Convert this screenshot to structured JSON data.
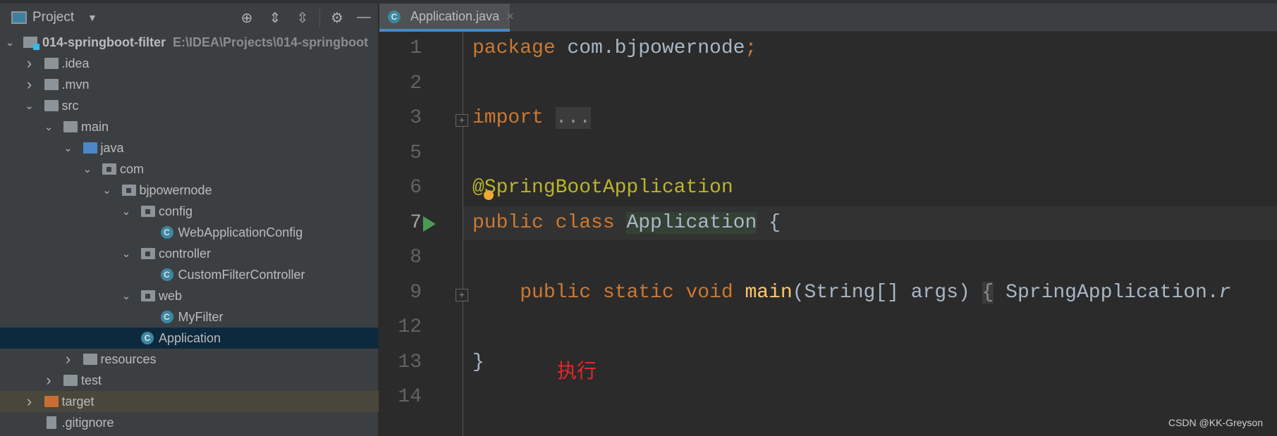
{
  "sidebar": {
    "title": "Project",
    "header_icons": [
      "locate-icon",
      "expand-all-icon",
      "collapse-all-icon",
      "gear-icon",
      "minimize-icon"
    ],
    "root": {
      "label": "014-springboot-filter",
      "path": "E:\\IDEA\\Projects\\014-springboot"
    },
    "items": [
      {
        "label": ".idea",
        "level": 1,
        "type": "folder",
        "expanded": false
      },
      {
        "label": ".mvn",
        "level": 1,
        "type": "folder",
        "expanded": false
      },
      {
        "label": "src",
        "level": 1,
        "type": "folder",
        "expanded": true
      },
      {
        "label": "main",
        "level": 2,
        "type": "folder",
        "expanded": true
      },
      {
        "label": "java",
        "level": 3,
        "type": "source-folder",
        "expanded": true
      },
      {
        "label": "com",
        "level": 4,
        "type": "package",
        "expanded": true
      },
      {
        "label": "bjpowernode",
        "level": 5,
        "type": "package",
        "expanded": true
      },
      {
        "label": "config",
        "level": 6,
        "type": "package",
        "expanded": true
      },
      {
        "label": "WebApplicationConfig",
        "level": 7,
        "type": "class"
      },
      {
        "label": "controller",
        "level": 6,
        "type": "package",
        "expanded": true
      },
      {
        "label": "CustomFilterController",
        "level": 7,
        "type": "class"
      },
      {
        "label": "web",
        "level": 6,
        "type": "package",
        "expanded": true
      },
      {
        "label": "MyFilter",
        "level": 7,
        "type": "class"
      },
      {
        "label": "Application",
        "level": 6,
        "type": "spring-class",
        "selected": true
      },
      {
        "label": "resources",
        "level": 3,
        "type": "resources-folder",
        "expanded": false
      },
      {
        "label": "test",
        "level": 2,
        "type": "folder",
        "expanded": false
      },
      {
        "label": "target",
        "level": 1,
        "type": "excluded-folder",
        "expanded": false,
        "highlighted": true
      },
      {
        "label": ".gitignore",
        "level": 1,
        "type": "file"
      }
    ]
  },
  "tab": {
    "label": "Application.java",
    "close": "×"
  },
  "editor": {
    "lines": [
      {
        "num": "1",
        "html": "<span class='kw'>package</span> com.bjpowernode<span class='kw'>;</span>"
      },
      {
        "num": "2",
        "html": ""
      },
      {
        "num": "3",
        "html": "<span class='kw'>import</span> <span class='fold'>...</span>",
        "fold": true
      },
      {
        "num": "5",
        "html": ""
      },
      {
        "num": "6",
        "html": "<span class='an'>@SpringBootApplication</span>"
      },
      {
        "num": "7",
        "html": "<span class='kw'>public class</span> <span class='hl'>Application</span> {",
        "current": true,
        "run": true
      },
      {
        "num": "8",
        "html": ""
      },
      {
        "num": "9",
        "html": "    <span class='kw'>public static void</span> <span class='fn'>main</span>(String[] args) <span class='fold'>{</span> SpringApplication.<i>r</i>",
        "fold": true
      },
      {
        "num": "12",
        "html": ""
      },
      {
        "num": "13",
        "html": "}"
      },
      {
        "num": "14",
        "html": ""
      }
    ]
  },
  "annotation": "执行",
  "watermark": "CSDN @KK-Greyson",
  "colors": {
    "keyword": "#cc7832",
    "annotation": "#bbb529",
    "method": "#ffc66d",
    "selection": "#0d293e",
    "accent": "#4a88c7"
  }
}
